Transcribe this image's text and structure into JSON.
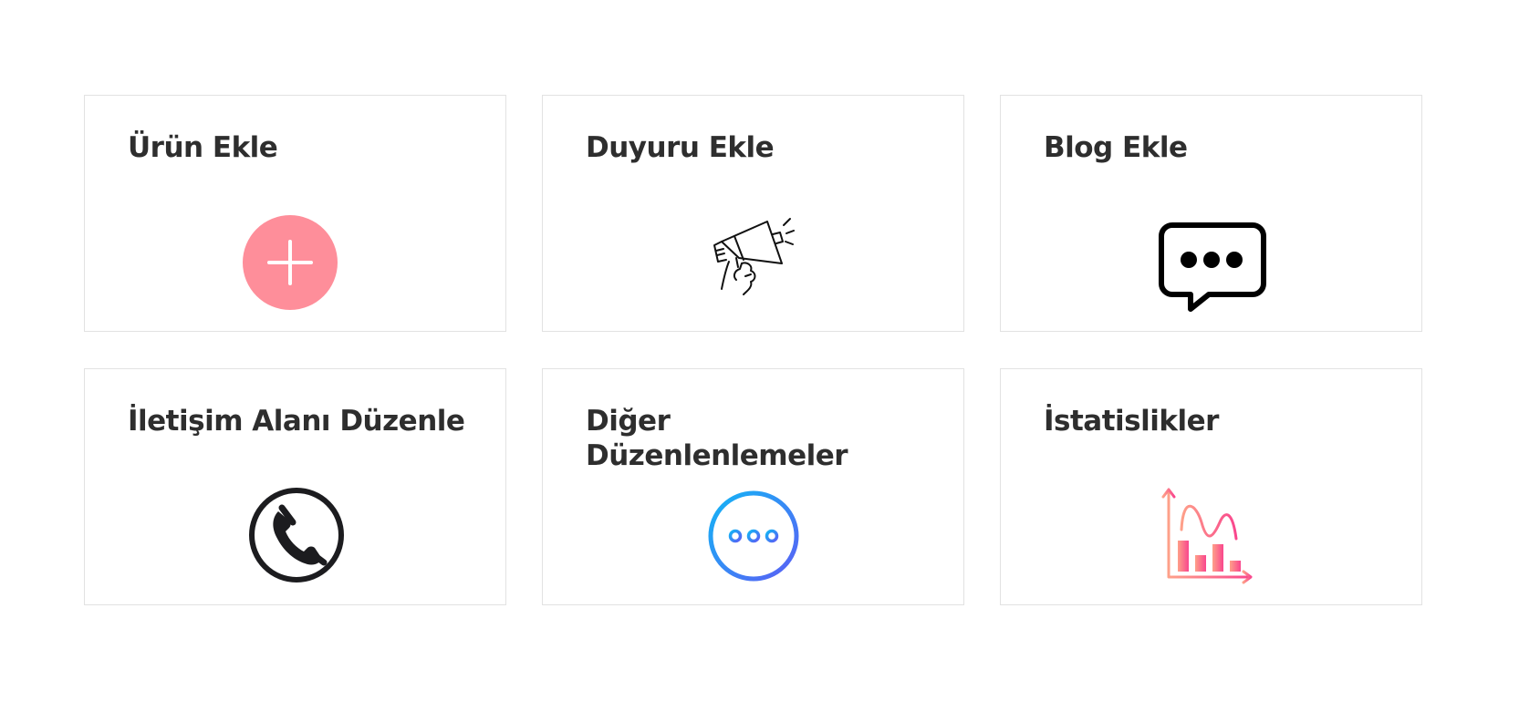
{
  "cards": [
    {
      "title": "Ürün Ekle",
      "icon": "plus-circle-icon",
      "color": "#fe8e9a"
    },
    {
      "title": "Duyuru Ekle",
      "icon": "megaphone-icon",
      "color": "#111111"
    },
    {
      "title": "Blog Ekle",
      "icon": "chat-bubble-icon",
      "color": "#000000"
    },
    {
      "title": "İletişim Alanı Düzenle",
      "icon": "phone-icon",
      "color": "#1c1c1f"
    },
    {
      "title": "Diğer Düzenlenlemeler",
      "icon": "more-icon",
      "colors": [
        "#12b6f5",
        "#5b5ef5"
      ]
    },
    {
      "title": "İstatislikler",
      "icon": "statistics-chart-icon",
      "colors": [
        "#fea089",
        "#f9468d"
      ]
    }
  ]
}
